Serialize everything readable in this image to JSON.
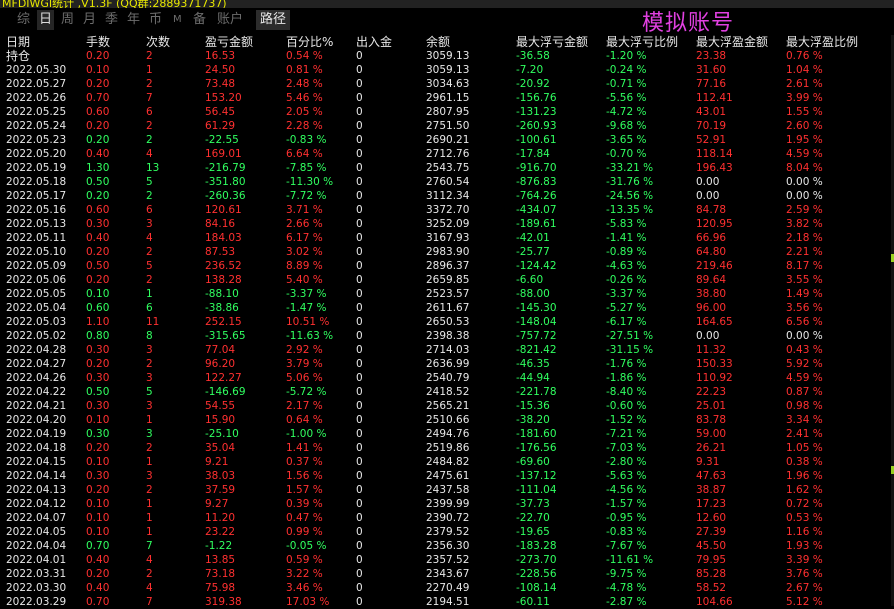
{
  "title_bar": "MFDIWGI统计 ,V1.3F (QQ群:2889371737)",
  "overlay_label": "模拟账号",
  "tabs": [
    {
      "label": "综",
      "active": false
    },
    {
      "label": "日",
      "active": true
    },
    {
      "label": "周",
      "active": false
    },
    {
      "label": "月",
      "active": false
    },
    {
      "label": "季",
      "active": false
    },
    {
      "label": "年",
      "active": false
    },
    {
      "label": "币",
      "active": false
    },
    {
      "label": "M",
      "active": false
    },
    {
      "label": "备",
      "active": false
    },
    {
      "label": "账户",
      "active": false
    },
    {
      "label": "路径",
      "active": false
    }
  ],
  "columns": [
    "日期",
    "手数",
    "次数",
    "盈亏金额",
    "百分比%",
    "出入金",
    "余额",
    "最大浮亏金额",
    "最大浮亏比例",
    "最大浮盈金额",
    "最大浮盈比例"
  ],
  "position_label": "持仓",
  "colors": {
    "up": "#ff3030",
    "down": "#30ff60",
    "neutral": "#e8e8e8",
    "overlay": "#e040e0"
  },
  "rows": [
    {
      "d": "",
      "c": "r",
      "v": [
        "0.20",
        "2",
        "16.53",
        "0.54 %",
        "0",
        "3059.13",
        "-36.58",
        "-1.20 %",
        "23.38",
        "0.76 %"
      ]
    },
    {
      "d": "2022.05.30",
      "c": "r",
      "v": [
        "0.10",
        "1",
        "24.50",
        "0.81 %",
        "0",
        "3059.13",
        "-7.20",
        "-0.24 %",
        "31.60",
        "1.04 %"
      ]
    },
    {
      "d": "2022.05.27",
      "c": "r",
      "v": [
        "0.20",
        "2",
        "73.48",
        "2.48 %",
        "0",
        "3034.63",
        "-20.92",
        "-0.71 %",
        "77.16",
        "2.61 %"
      ]
    },
    {
      "d": "2022.05.26",
      "c": "r",
      "v": [
        "0.70",
        "7",
        "153.20",
        "5.46 %",
        "0",
        "2961.15",
        "-156.76",
        "-5.56 %",
        "112.41",
        "3.99 %"
      ]
    },
    {
      "d": "2022.05.25",
      "c": "r",
      "v": [
        "0.60",
        "6",
        "56.45",
        "2.05 %",
        "0",
        "2807.95",
        "-131.23",
        "-4.72 %",
        "43.01",
        "1.55 %"
      ]
    },
    {
      "d": "2022.05.24",
      "c": "r",
      "v": [
        "0.20",
        "2",
        "61.29",
        "2.28 %",
        "0",
        "2751.50",
        "-260.93",
        "-9.68 %",
        "70.19",
        "2.60 %"
      ]
    },
    {
      "d": "2022.05.23",
      "c": "g",
      "v": [
        "0.20",
        "2",
        "-22.55",
        "-0.83 %",
        "0",
        "2690.21",
        "-100.61",
        "-3.65 %",
        "52.91",
        "1.95 %"
      ]
    },
    {
      "d": "2022.05.20",
      "c": "r",
      "v": [
        "0.40",
        "4",
        "169.01",
        "6.64 %",
        "0",
        "2712.76",
        "-17.84",
        "-0.70 %",
        "118.14",
        "4.59 %"
      ]
    },
    {
      "d": "2022.05.19",
      "c": "g",
      "v": [
        "1.30",
        "13",
        "-216.79",
        "-7.85 %",
        "0",
        "2543.75",
        "-916.70",
        "-33.21 %",
        "196.43",
        "8.04 %"
      ]
    },
    {
      "d": "2022.05.18",
      "c": "g",
      "v": [
        "0.50",
        "5",
        "-351.80",
        "-11.30 %",
        "0",
        "2760.54",
        "-876.83",
        "-31.76 %",
        "0.00",
        "0.00 %"
      ]
    },
    {
      "d": "2022.05.17",
      "c": "g",
      "v": [
        "0.20",
        "2",
        "-260.36",
        "-7.72 %",
        "0",
        "3112.34",
        "-764.26",
        "-24.56 %",
        "0.00",
        "0.00 %"
      ]
    },
    {
      "d": "2022.05.16",
      "c": "r",
      "v": [
        "0.60",
        "6",
        "120.61",
        "3.71 %",
        "0",
        "3372.70",
        "-434.07",
        "-13.35 %",
        "84.78",
        "2.59 %"
      ]
    },
    {
      "d": "2022.05.13",
      "c": "r",
      "v": [
        "0.30",
        "3",
        "84.16",
        "2.66 %",
        "0",
        "3252.09",
        "-189.61",
        "-5.83 %",
        "120.95",
        "3.82 %"
      ]
    },
    {
      "d": "2022.05.11",
      "c": "r",
      "v": [
        "0.40",
        "4",
        "184.03",
        "6.17 %",
        "0",
        "3167.93",
        "-42.01",
        "-1.41 %",
        "66.96",
        "2.18 %"
      ]
    },
    {
      "d": "2022.05.10",
      "c": "r",
      "v": [
        "0.20",
        "2",
        "87.53",
        "3.02 %",
        "0",
        "2983.90",
        "-25.77",
        "-0.89 %",
        "64.80",
        "2.21 %"
      ]
    },
    {
      "d": "2022.05.09",
      "c": "r",
      "v": [
        "0.50",
        "5",
        "236.52",
        "8.89 %",
        "0",
        "2896.37",
        "-124.42",
        "-4.63 %",
        "219.46",
        "8.17 %"
      ]
    },
    {
      "d": "2022.05.06",
      "c": "r",
      "v": [
        "0.20",
        "2",
        "138.28",
        "5.40 %",
        "0",
        "2659.85",
        "-6.60",
        "-0.26 %",
        "89.64",
        "3.55 %"
      ]
    },
    {
      "d": "2022.05.05",
      "c": "g",
      "v": [
        "0.10",
        "1",
        "-88.10",
        "-3.37 %",
        "0",
        "2523.57",
        "-88.00",
        "-3.37 %",
        "38.80",
        "1.49 %"
      ]
    },
    {
      "d": "2022.05.04",
      "c": "g",
      "v": [
        "0.60",
        "6",
        "-38.86",
        "-1.47 %",
        "0",
        "2611.67",
        "-145.30",
        "-5.27 %",
        "96.00",
        "3.56 %"
      ]
    },
    {
      "d": "2022.05.03",
      "c": "r",
      "v": [
        "1.10",
        "11",
        "252.15",
        "10.51 %",
        "0",
        "2650.53",
        "-148.04",
        "-6.17 %",
        "164.65",
        "6.56 %"
      ]
    },
    {
      "d": "2022.05.02",
      "c": "g",
      "v": [
        "0.80",
        "8",
        "-315.65",
        "-11.63 %",
        "0",
        "2398.38",
        "-757.72",
        "-27.51 %",
        "0.00",
        "0.00 %"
      ]
    },
    {
      "d": "2022.04.28",
      "c": "r",
      "v": [
        "0.30",
        "3",
        "77.04",
        "2.92 %",
        "0",
        "2714.03",
        "-821.42",
        "-31.15 %",
        "11.32",
        "0.43 %"
      ]
    },
    {
      "d": "2022.04.27",
      "c": "r",
      "v": [
        "0.20",
        "2",
        "96.20",
        "3.79 %",
        "0",
        "2636.99",
        "-46.35",
        "-1.76 %",
        "150.33",
        "5.92 %"
      ]
    },
    {
      "d": "2022.04.26",
      "c": "r",
      "v": [
        "0.30",
        "3",
        "122.27",
        "5.06 %",
        "0",
        "2540.79",
        "-44.94",
        "-1.86 %",
        "110.92",
        "4.59 %"
      ]
    },
    {
      "d": "2022.04.22",
      "c": "g",
      "v": [
        "0.50",
        "5",
        "-146.69",
        "-5.72 %",
        "0",
        "2418.52",
        "-221.78",
        "-8.40 %",
        "22.23",
        "0.87 %"
      ]
    },
    {
      "d": "2022.04.21",
      "c": "r",
      "v": [
        "0.30",
        "3",
        "54.55",
        "2.17 %",
        "0",
        "2565.21",
        "-15.36",
        "-0.60 %",
        "25.01",
        "0.98 %"
      ]
    },
    {
      "d": "2022.04.20",
      "c": "r",
      "v": [
        "0.10",
        "1",
        "15.90",
        "0.64 %",
        "0",
        "2510.66",
        "-38.20",
        "-1.52 %",
        "83.78",
        "3.34 %"
      ]
    },
    {
      "d": "2022.04.19",
      "c": "g",
      "v": [
        "0.30",
        "3",
        "-25.10",
        "-1.00 %",
        "0",
        "2494.76",
        "-181.60",
        "-7.21 %",
        "59.00",
        "2.41 %"
      ]
    },
    {
      "d": "2022.04.18",
      "c": "r",
      "v": [
        "0.20",
        "2",
        "35.04",
        "1.41 %",
        "0",
        "2519.86",
        "-176.56",
        "-7.03 %",
        "26.21",
        "1.05 %"
      ]
    },
    {
      "d": "2022.04.15",
      "c": "r",
      "v": [
        "0.10",
        "1",
        "9.21",
        "0.37 %",
        "0",
        "2484.82",
        "-69.60",
        "-2.80 %",
        "9.31",
        "0.38 %"
      ]
    },
    {
      "d": "2022.04.14",
      "c": "r",
      "v": [
        "0.30",
        "3",
        "38.03",
        "1.56 %",
        "0",
        "2475.61",
        "-137.12",
        "-5.63 %",
        "47.63",
        "1.96 %"
      ]
    },
    {
      "d": "2022.04.13",
      "c": "r",
      "v": [
        "0.20",
        "2",
        "37.59",
        "1.57 %",
        "0",
        "2437.58",
        "-111.04",
        "-4.56 %",
        "38.87",
        "1.62 %"
      ]
    },
    {
      "d": "2022.04.12",
      "c": "r",
      "v": [
        "0.10",
        "1",
        "9.27",
        "0.39 %",
        "0",
        "2399.99",
        "-37.73",
        "-1.57 %",
        "17.23",
        "0.72 %"
      ]
    },
    {
      "d": "2022.04.07",
      "c": "r",
      "v": [
        "0.10",
        "1",
        "11.20",
        "0.47 %",
        "0",
        "2390.72",
        "-22.70",
        "-0.95 %",
        "12.60",
        "0.53 %"
      ]
    },
    {
      "d": "2022.04.05",
      "c": "r",
      "v": [
        "0.10",
        "1",
        "23.22",
        "0.99 %",
        "0",
        "2379.52",
        "-19.65",
        "-0.83 %",
        "27.39",
        "1.16 %"
      ]
    },
    {
      "d": "2022.04.04",
      "c": "g",
      "v": [
        "0.70",
        "7",
        "-1.22",
        "-0.05 %",
        "0",
        "2356.30",
        "-183.28",
        "-7.67 %",
        "45.50",
        "1.93 %"
      ]
    },
    {
      "d": "2022.04.01",
      "c": "r",
      "v": [
        "0.40",
        "4",
        "13.85",
        "0.59 %",
        "0",
        "2357.52",
        "-273.70",
        "-11.61 %",
        "79.95",
        "3.39 %"
      ]
    },
    {
      "d": "2022.03.31",
      "c": "r",
      "v": [
        "0.20",
        "2",
        "73.18",
        "3.22 %",
        "0",
        "2343.67",
        "-228.56",
        "-9.75 %",
        "85.28",
        "3.76 %"
      ]
    },
    {
      "d": "2022.03.30",
      "c": "r",
      "v": [
        "0.40",
        "4",
        "75.98",
        "3.46 %",
        "0",
        "2270.49",
        "-108.14",
        "-4.78 %",
        "58.52",
        "2.67 %"
      ]
    },
    {
      "d": "2022.03.29",
      "c": "r",
      "v": [
        "0.70",
        "7",
        "319.38",
        "17.03 %",
        "0",
        "2194.51",
        "-60.11",
        "-2.87 %",
        "104.66",
        "5.12 %"
      ]
    }
  ]
}
